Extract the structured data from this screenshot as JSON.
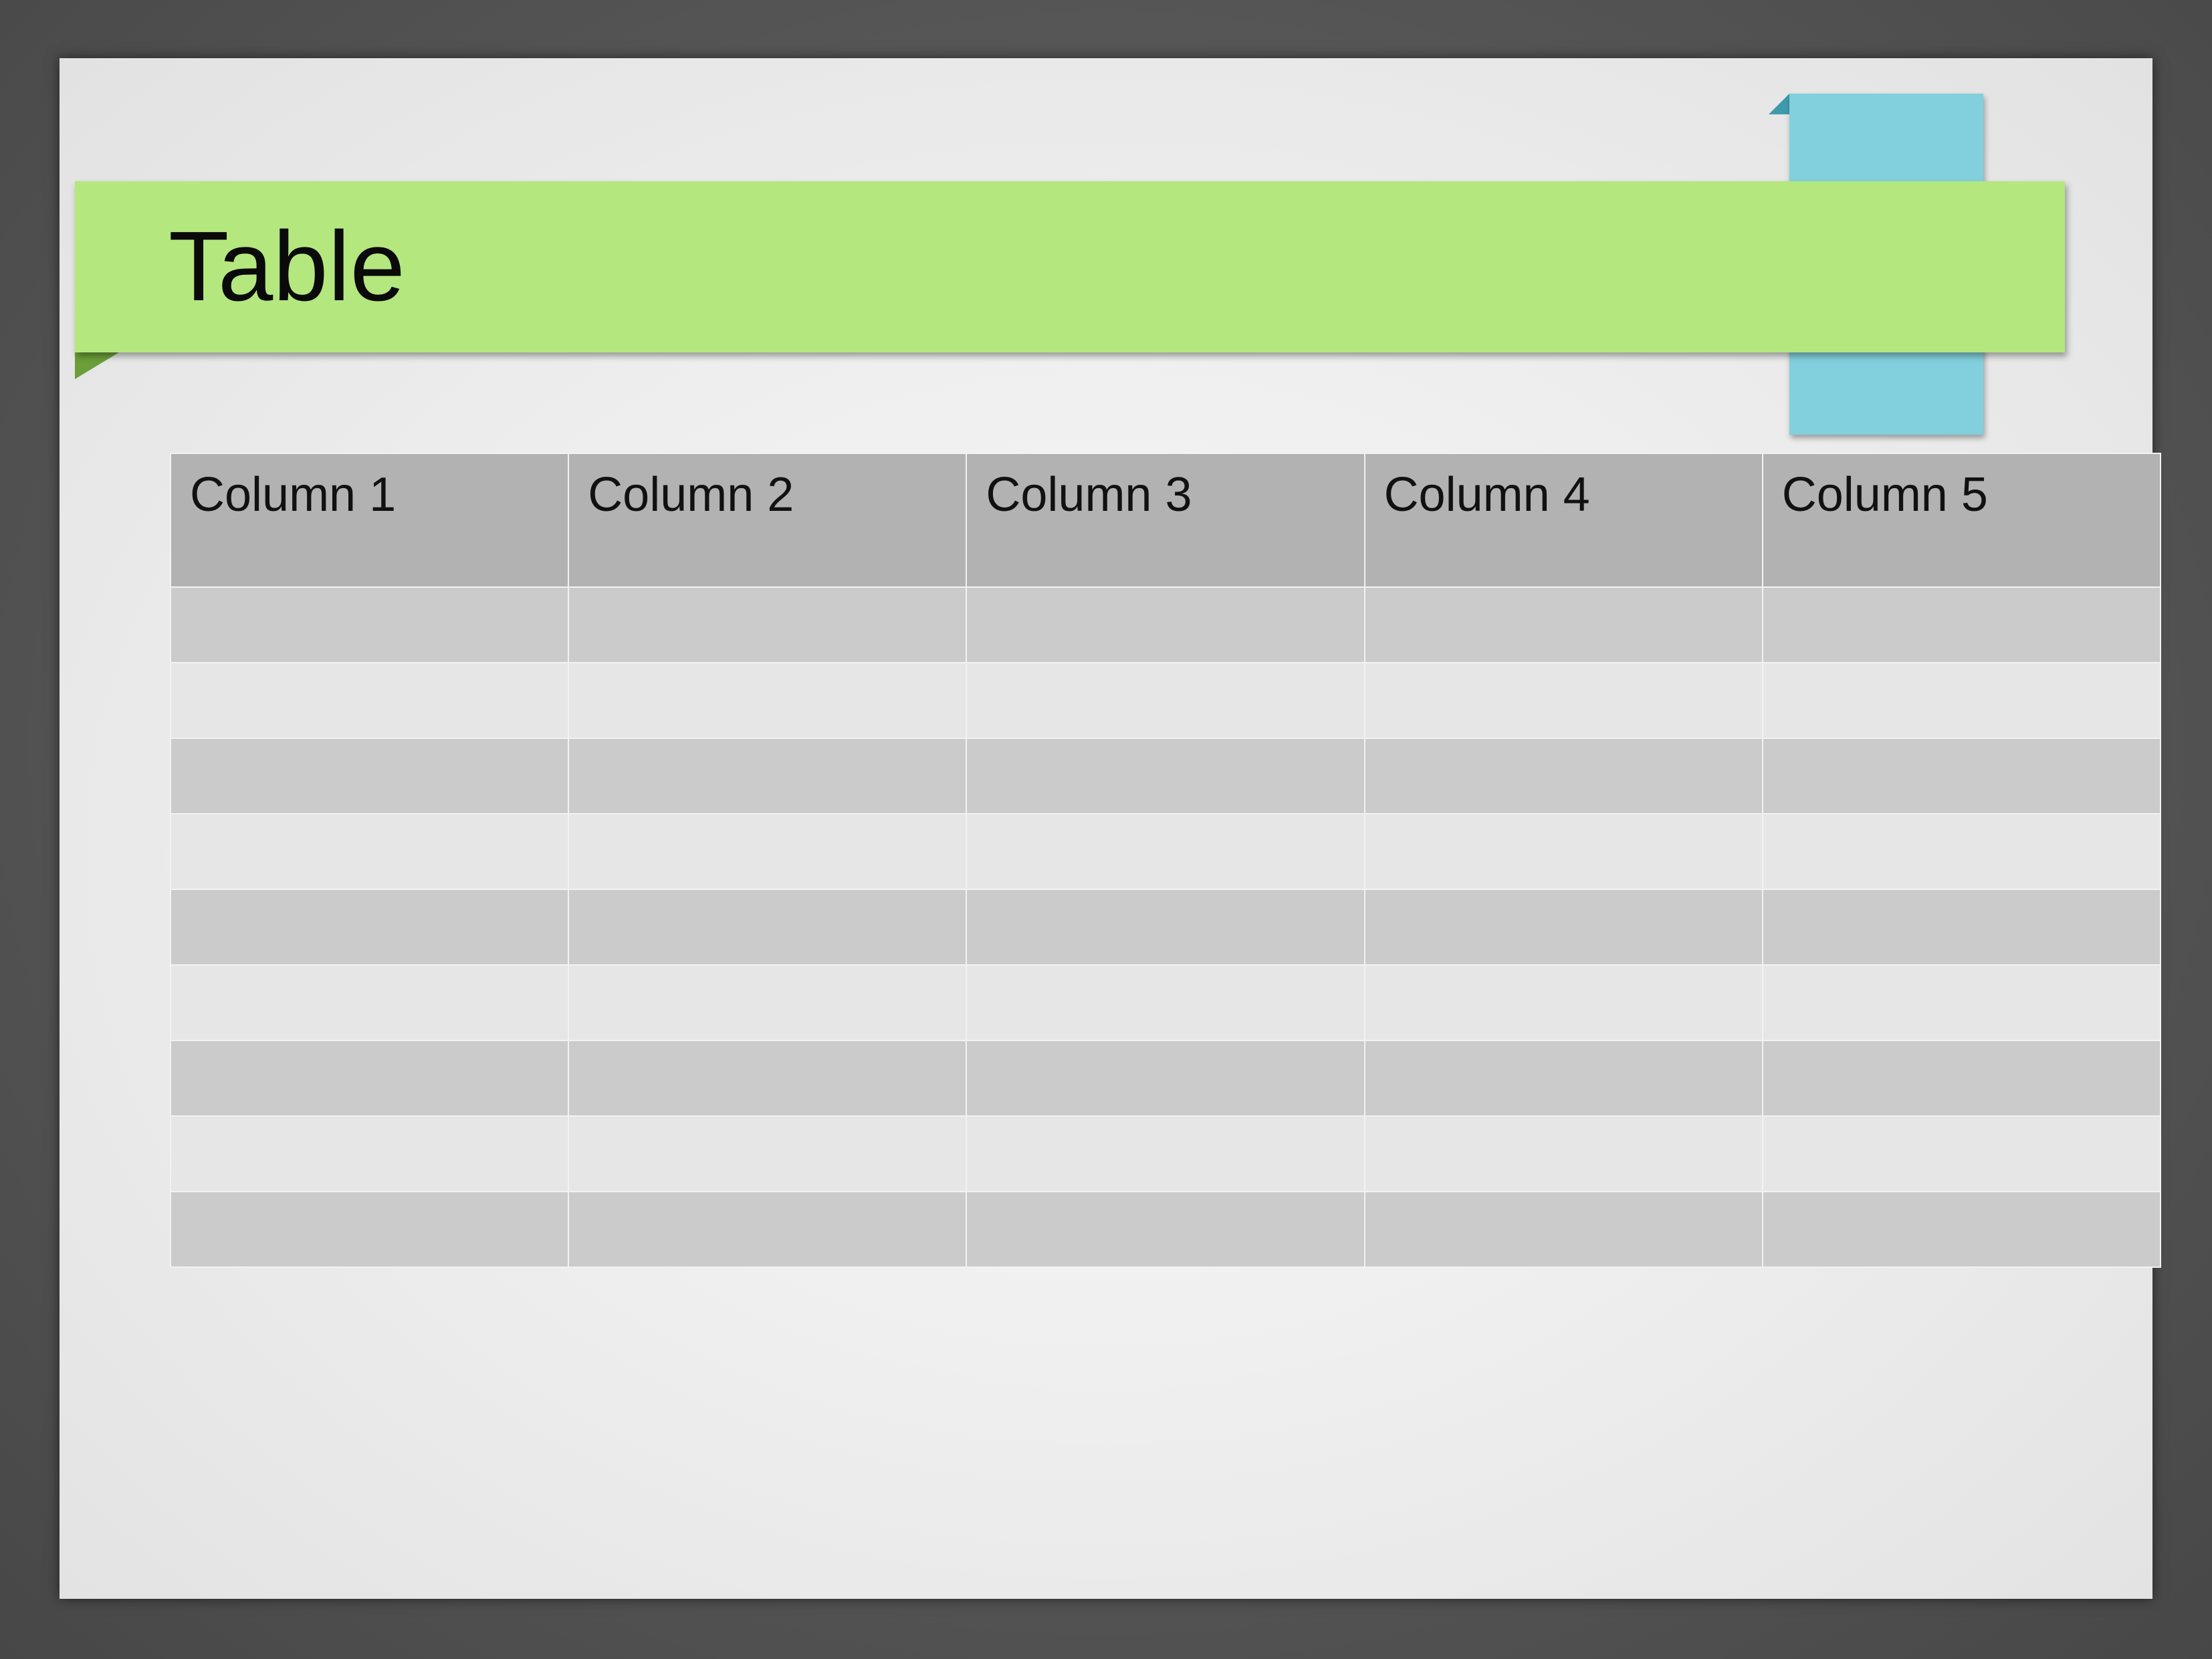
{
  "slide": {
    "title": "Table"
  },
  "table": {
    "columns": [
      "Column 1",
      "Column 2",
      "Column 3",
      "Column 4",
      "Column 5"
    ],
    "rows": [
      [
        "",
        "",
        "",
        "",
        ""
      ],
      [
        "",
        "",
        "",
        "",
        ""
      ],
      [
        "",
        "",
        "",
        "",
        ""
      ],
      [
        "",
        "",
        "",
        "",
        ""
      ],
      [
        "",
        "",
        "",
        "",
        ""
      ],
      [
        "",
        "",
        "",
        "",
        ""
      ],
      [
        "",
        "",
        "",
        "",
        ""
      ],
      [
        "",
        "",
        "",
        "",
        ""
      ],
      [
        "",
        "",
        "",
        "",
        ""
      ]
    ]
  },
  "colors": {
    "title_band": "#b5e77f",
    "accent_tab": "#82d0dd",
    "header_fill": "#b2b2b2",
    "row_dark": "#cbcbcb",
    "row_light": "#e6e6e6"
  }
}
